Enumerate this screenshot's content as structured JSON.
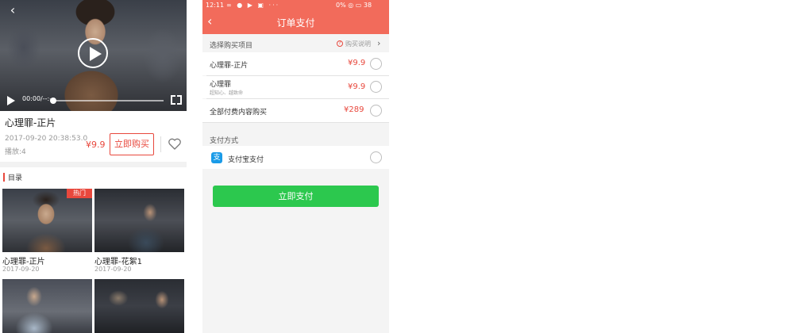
{
  "left_screen": {
    "player": {
      "time": "00:00/--:--"
    },
    "video": {
      "title": "心理罪-正片",
      "date": "2017-09-20 20:38:53.0",
      "plays": "播放:4",
      "price": "¥9.9",
      "buy_label": "立即购买"
    },
    "catalog": {
      "title": "目录",
      "items": [
        {
          "title": "心理罪-正片",
          "date": "2017-09-20",
          "badge": "热门"
        },
        {
          "title": "心理罪-花絮1",
          "date": "2017-09-20"
        }
      ]
    }
  },
  "right_screen": {
    "status_bar": {
      "time": "12:11",
      "right": "0%  ◎  ▭ 38"
    },
    "header": {
      "title": "订单支付"
    },
    "purchase_section": {
      "title": "选择购买项目",
      "info_label": "购买说明",
      "items": [
        {
          "name": "心理罪-正片",
          "subtitle": "",
          "price": "¥9.9"
        },
        {
          "name": "心理罪",
          "subtitle": "超知心、越致命",
          "price": "¥9.9"
        },
        {
          "name": "全部付费内容购买",
          "subtitle": "",
          "price": "¥289"
        }
      ]
    },
    "payment_section": {
      "title": "支付方式",
      "method": "支付宝支付",
      "method_icon": "支"
    },
    "pay_button": "立即支付",
    "colors": {
      "accent": "#f26b5b",
      "price": "#e8483d",
      "pay_button": "#2cc84e"
    }
  }
}
